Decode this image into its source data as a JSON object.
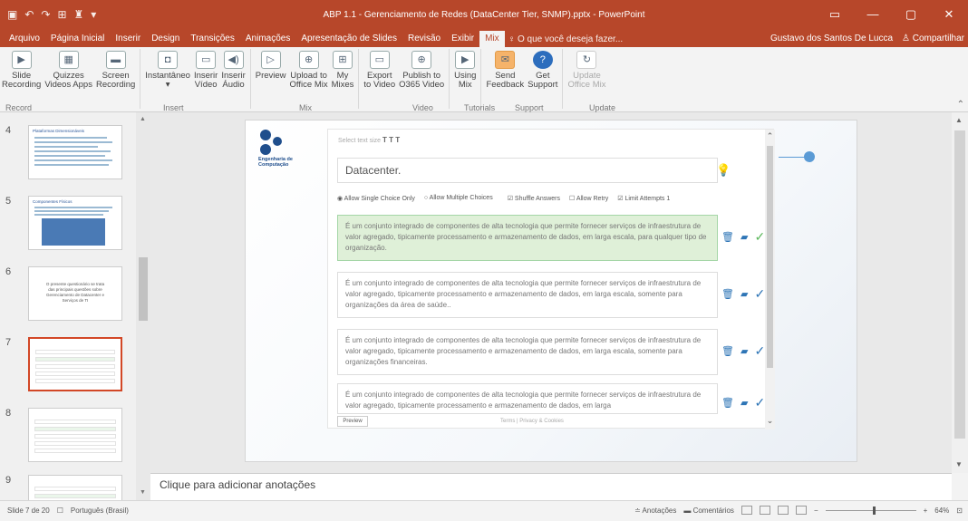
{
  "window": {
    "title": "ABP 1.1 - Gerenciamento de Redes (DataCenter Tier, SNMP).pptx - PowerPoint",
    "qat": [
      "▣",
      "↶",
      "↷",
      "⊞",
      "♜",
      "▾"
    ],
    "controls": [
      "▭",
      "—",
      "▢",
      "✕"
    ]
  },
  "menu": {
    "tabs": [
      "Arquivo",
      "Página Inicial",
      "Inserir",
      "Design",
      "Transições",
      "Animações",
      "Apresentação de Slides",
      "Revisão",
      "Exibir",
      "Mix"
    ],
    "active_tab": "Mix",
    "tell_me": "♀ O que você deseja fazer...",
    "user": "Gustavo dos Santos De Lucca",
    "share": "♙ Compartilhar"
  },
  "ribbon": {
    "buttons": [
      {
        "label": "Slide\nRecording",
        "icon": "slide-recording"
      },
      {
        "label": "Quizzes\nVideos Apps",
        "icon": "quizzes"
      },
      {
        "label": "Screen\nRecording",
        "icon": "screen-recording"
      },
      {
        "label": "Instantâneo\n▾",
        "icon": "screenshot"
      },
      {
        "label": "Inserir\nVídeo",
        "icon": "insert-video"
      },
      {
        "label": "Inserir\nÁudio",
        "icon": "insert-audio"
      },
      {
        "label": "Preview",
        "icon": "preview"
      },
      {
        "label": "Upload to\nOffice Mix",
        "icon": "upload"
      },
      {
        "label": "My\nMixes",
        "icon": "my-mixes"
      },
      {
        "label": "Export\nto Video",
        "icon": "export"
      },
      {
        "label": "Publish to\nO365 Video",
        "icon": "publish"
      },
      {
        "label": "Using\nMix",
        "icon": "using-mix"
      },
      {
        "label": "Send\nFeedback",
        "icon": "send-feedback"
      },
      {
        "label": "Get\nSupport",
        "icon": "get-support"
      },
      {
        "label": "Update\nOffice Mix",
        "icon": "update",
        "disabled": true
      }
    ],
    "groups": [
      "Record",
      "Insert",
      "Mix",
      "Video",
      "Tutorials",
      "Support",
      "Update"
    ]
  },
  "thumbnails": [
    {
      "num": "4",
      "title": "Plataformas Dimensionáveis"
    },
    {
      "num": "5",
      "title": "Componentes Físicos"
    },
    {
      "num": "6",
      "text": "O presente questionário se trata das principais questões sobre Gerenciamento de Datacenter e Serviços de TI"
    },
    {
      "num": "7",
      "selected": true
    },
    {
      "num": "8"
    },
    {
      "num": "9"
    }
  ],
  "slide": {
    "logo_text": "Engenharia de Computação",
    "quiz": {
      "header_small": "Select text size",
      "header_sizes": "T T T",
      "question": "Datacenter.",
      "options": {
        "single": "◉ Allow Single Choice Only",
        "multiple": "○ Allow Multiple Choices",
        "shuffle": "☑ Shuffle Answers",
        "retry": "☐ Allow Retry",
        "limit": "☑ Limit Attempts 1"
      },
      "answers": [
        {
          "text": "É um conjunto integrado de componentes de alta tecnologia que permite fornecer serviços de infraestrutura de valor agregado, tipicamente processamento e armazenamento de dados, em larga escala, para qualquer tipo de organização.",
          "correct": true
        },
        {
          "text": "É um conjunto integrado de componentes de alta tecnologia que permite fornecer serviços de infraestrutura de valor agregado, tipicamente processamento e armazenamento de dados, em larga escala, somente para organizações da área de saúde..",
          "correct": false
        },
        {
          "text": "É um conjunto integrado de componentes de alta tecnologia que permite fornecer serviços de infraestrutura de valor agregado, tipicamente processamento e armazenamento de dados, em larga escala, somente para organizações financeiras.",
          "correct": false
        },
        {
          "text": "É um conjunto integrado de componentes de alta tecnologia que permite fornecer serviços de infraestrutura de valor agregado, tipicamente processamento e armazenamento de dados, em larga",
          "correct": false
        }
      ],
      "preview_label": "Preview",
      "terms": "Terms | Privacy & Cookies"
    }
  },
  "notes_placeholder": "Clique para adicionar anotações",
  "status": {
    "slide_info": "Slide 7 de 20",
    "language": "Português (Brasil)",
    "notes": "≐ Anotações",
    "comments": "▬ Comentários",
    "zoom": "64%"
  }
}
